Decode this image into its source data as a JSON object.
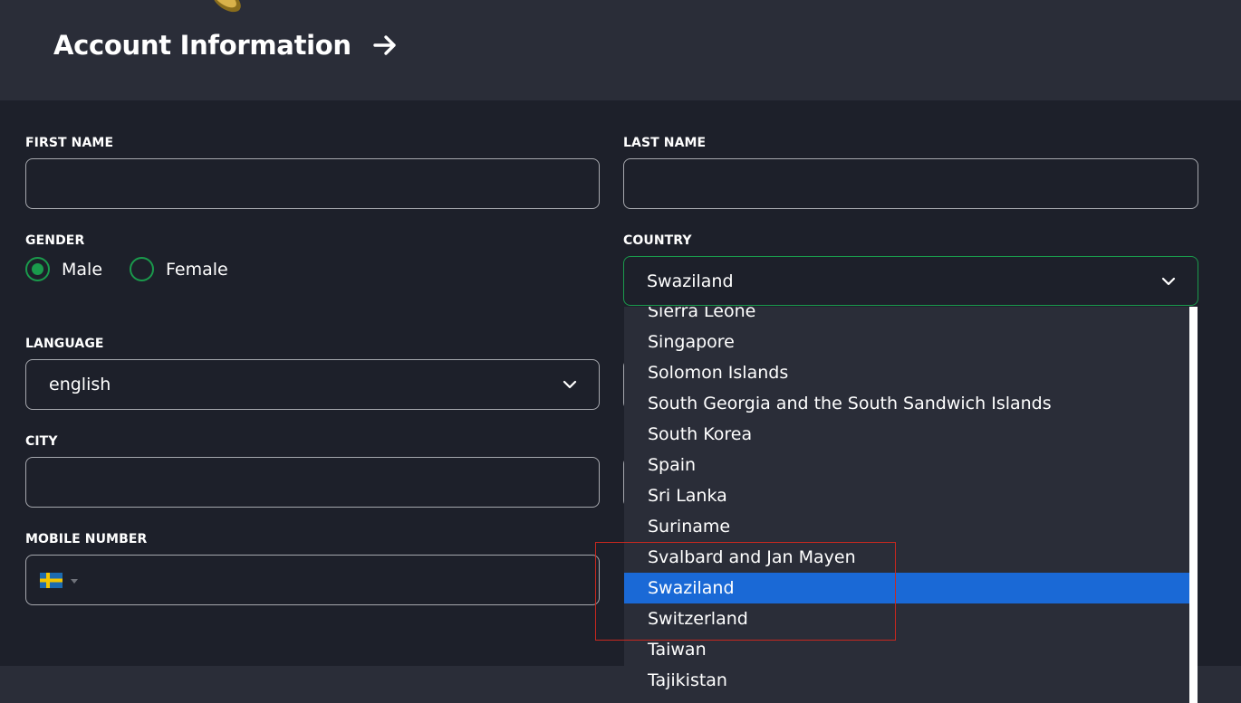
{
  "header": {
    "title": "Account Information"
  },
  "form": {
    "first_name": {
      "label": "FIRST NAME",
      "value": ""
    },
    "last_name": {
      "label": "LAST NAME",
      "value": ""
    },
    "gender": {
      "label": "GENDER",
      "options": [
        "Male",
        "Female"
      ],
      "selected": "Male"
    },
    "country": {
      "label": "COUNTRY",
      "value": "Swaziland"
    },
    "language": {
      "label": "LANGUAGE",
      "value": "english"
    },
    "city": {
      "label": "CITY",
      "value": ""
    },
    "mobile": {
      "label": "MOBILE NUMBER",
      "value": "",
      "flag": "sweden-flag-icon"
    }
  },
  "country_dropdown": {
    "options": [
      "Sierra Leone",
      "Singapore",
      "Solomon Islands",
      "South Georgia and the South Sandwich Islands",
      "South Korea",
      "Spain",
      "Sri Lanka",
      "Suriname",
      "Svalbard and Jan Mayen",
      "Swaziland",
      "Switzerland",
      "Taiwan",
      "Tajikistan"
    ],
    "selected": "Swaziland"
  },
  "colors": {
    "background": "#1d202a",
    "header_bg": "#2a2d38",
    "accent_green": "#1a9a4c",
    "selected_option": "#1a69d6",
    "highlight_box": "#c8281f"
  }
}
